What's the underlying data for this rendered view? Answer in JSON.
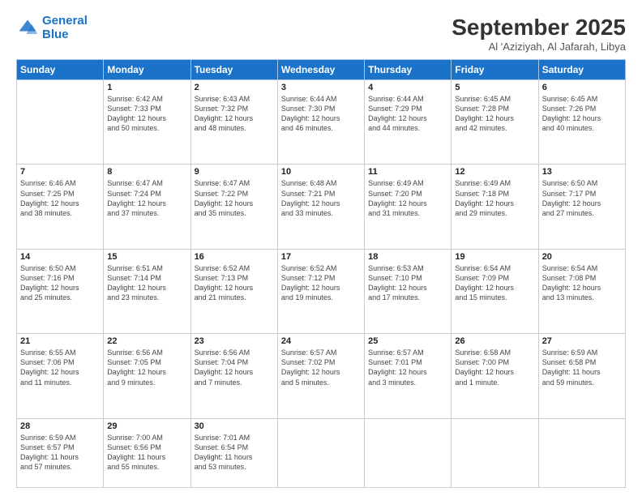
{
  "logo": {
    "line1": "General",
    "line2": "Blue"
  },
  "title": "September 2025",
  "location": "Al 'Aziziyah, Al Jafarah, Libya",
  "weekdays": [
    "Sunday",
    "Monday",
    "Tuesday",
    "Wednesday",
    "Thursday",
    "Friday",
    "Saturday"
  ],
  "weeks": [
    [
      {
        "day": "",
        "info": ""
      },
      {
        "day": "1",
        "info": "Sunrise: 6:42 AM\nSunset: 7:33 PM\nDaylight: 12 hours\nand 50 minutes."
      },
      {
        "day": "2",
        "info": "Sunrise: 6:43 AM\nSunset: 7:32 PM\nDaylight: 12 hours\nand 48 minutes."
      },
      {
        "day": "3",
        "info": "Sunrise: 6:44 AM\nSunset: 7:30 PM\nDaylight: 12 hours\nand 46 minutes."
      },
      {
        "day": "4",
        "info": "Sunrise: 6:44 AM\nSunset: 7:29 PM\nDaylight: 12 hours\nand 44 minutes."
      },
      {
        "day": "5",
        "info": "Sunrise: 6:45 AM\nSunset: 7:28 PM\nDaylight: 12 hours\nand 42 minutes."
      },
      {
        "day": "6",
        "info": "Sunrise: 6:45 AM\nSunset: 7:26 PM\nDaylight: 12 hours\nand 40 minutes."
      }
    ],
    [
      {
        "day": "7",
        "info": "Sunrise: 6:46 AM\nSunset: 7:25 PM\nDaylight: 12 hours\nand 38 minutes."
      },
      {
        "day": "8",
        "info": "Sunrise: 6:47 AM\nSunset: 7:24 PM\nDaylight: 12 hours\nand 37 minutes."
      },
      {
        "day": "9",
        "info": "Sunrise: 6:47 AM\nSunset: 7:22 PM\nDaylight: 12 hours\nand 35 minutes."
      },
      {
        "day": "10",
        "info": "Sunrise: 6:48 AM\nSunset: 7:21 PM\nDaylight: 12 hours\nand 33 minutes."
      },
      {
        "day": "11",
        "info": "Sunrise: 6:49 AM\nSunset: 7:20 PM\nDaylight: 12 hours\nand 31 minutes."
      },
      {
        "day": "12",
        "info": "Sunrise: 6:49 AM\nSunset: 7:18 PM\nDaylight: 12 hours\nand 29 minutes."
      },
      {
        "day": "13",
        "info": "Sunrise: 6:50 AM\nSunset: 7:17 PM\nDaylight: 12 hours\nand 27 minutes."
      }
    ],
    [
      {
        "day": "14",
        "info": "Sunrise: 6:50 AM\nSunset: 7:16 PM\nDaylight: 12 hours\nand 25 minutes."
      },
      {
        "day": "15",
        "info": "Sunrise: 6:51 AM\nSunset: 7:14 PM\nDaylight: 12 hours\nand 23 minutes."
      },
      {
        "day": "16",
        "info": "Sunrise: 6:52 AM\nSunset: 7:13 PM\nDaylight: 12 hours\nand 21 minutes."
      },
      {
        "day": "17",
        "info": "Sunrise: 6:52 AM\nSunset: 7:12 PM\nDaylight: 12 hours\nand 19 minutes."
      },
      {
        "day": "18",
        "info": "Sunrise: 6:53 AM\nSunset: 7:10 PM\nDaylight: 12 hours\nand 17 minutes."
      },
      {
        "day": "19",
        "info": "Sunrise: 6:54 AM\nSunset: 7:09 PM\nDaylight: 12 hours\nand 15 minutes."
      },
      {
        "day": "20",
        "info": "Sunrise: 6:54 AM\nSunset: 7:08 PM\nDaylight: 12 hours\nand 13 minutes."
      }
    ],
    [
      {
        "day": "21",
        "info": "Sunrise: 6:55 AM\nSunset: 7:06 PM\nDaylight: 12 hours\nand 11 minutes."
      },
      {
        "day": "22",
        "info": "Sunrise: 6:56 AM\nSunset: 7:05 PM\nDaylight: 12 hours\nand 9 minutes."
      },
      {
        "day": "23",
        "info": "Sunrise: 6:56 AM\nSunset: 7:04 PM\nDaylight: 12 hours\nand 7 minutes."
      },
      {
        "day": "24",
        "info": "Sunrise: 6:57 AM\nSunset: 7:02 PM\nDaylight: 12 hours\nand 5 minutes."
      },
      {
        "day": "25",
        "info": "Sunrise: 6:57 AM\nSunset: 7:01 PM\nDaylight: 12 hours\nand 3 minutes."
      },
      {
        "day": "26",
        "info": "Sunrise: 6:58 AM\nSunset: 7:00 PM\nDaylight: 12 hours\nand 1 minute."
      },
      {
        "day": "27",
        "info": "Sunrise: 6:59 AM\nSunset: 6:58 PM\nDaylight: 11 hours\nand 59 minutes."
      }
    ],
    [
      {
        "day": "28",
        "info": "Sunrise: 6:59 AM\nSunset: 6:57 PM\nDaylight: 11 hours\nand 57 minutes."
      },
      {
        "day": "29",
        "info": "Sunrise: 7:00 AM\nSunset: 6:56 PM\nDaylight: 11 hours\nand 55 minutes."
      },
      {
        "day": "30",
        "info": "Sunrise: 7:01 AM\nSunset: 6:54 PM\nDaylight: 11 hours\nand 53 minutes."
      },
      {
        "day": "",
        "info": ""
      },
      {
        "day": "",
        "info": ""
      },
      {
        "day": "",
        "info": ""
      },
      {
        "day": "",
        "info": ""
      }
    ]
  ]
}
